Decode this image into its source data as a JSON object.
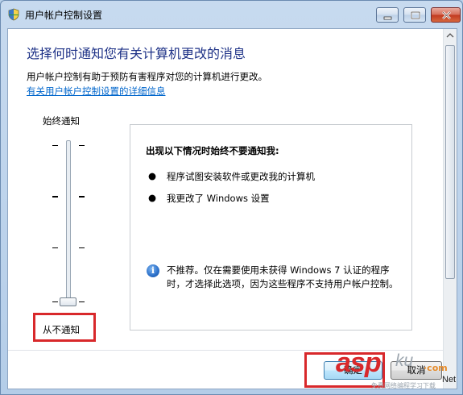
{
  "window": {
    "title": "用户帐户控制设置",
    "controls": {
      "minimize": "minimize",
      "maximize": "maximize",
      "close": "close"
    }
  },
  "main": {
    "heading": "选择何时通知您有关计算机更改的消息",
    "description": "用户帐户控制有助于预防有害程序对您的计算机进行更改。",
    "link": "有关用户帐户控制设置的详细信息"
  },
  "slider": {
    "top_label": "始终通知",
    "bottom_label": "从不通知",
    "levels": 4,
    "selected_level": 1
  },
  "info_panel": {
    "heading": "出现以下情况时始终不要通知我:",
    "bullets": [
      "程序试图安装软件或更改我的计算机",
      "我更改了 Windows 设置"
    ],
    "note": "不推荐。仅在需要使用未获得 Windows 7 认证的程序时，才选择此选项，因为这些程序不支持用户帐户控制。"
  },
  "buttons": {
    "ok": "确定",
    "cancel": "取消"
  },
  "watermark": {
    "brand": "asp",
    "suffix": "ku",
    "tag": "·com",
    "net": "Net",
    "sub": "免费网络编程学习下载"
  },
  "colors": {
    "heading": "#1e3287",
    "link": "#0066cc",
    "highlight_box": "#d8282b"
  }
}
